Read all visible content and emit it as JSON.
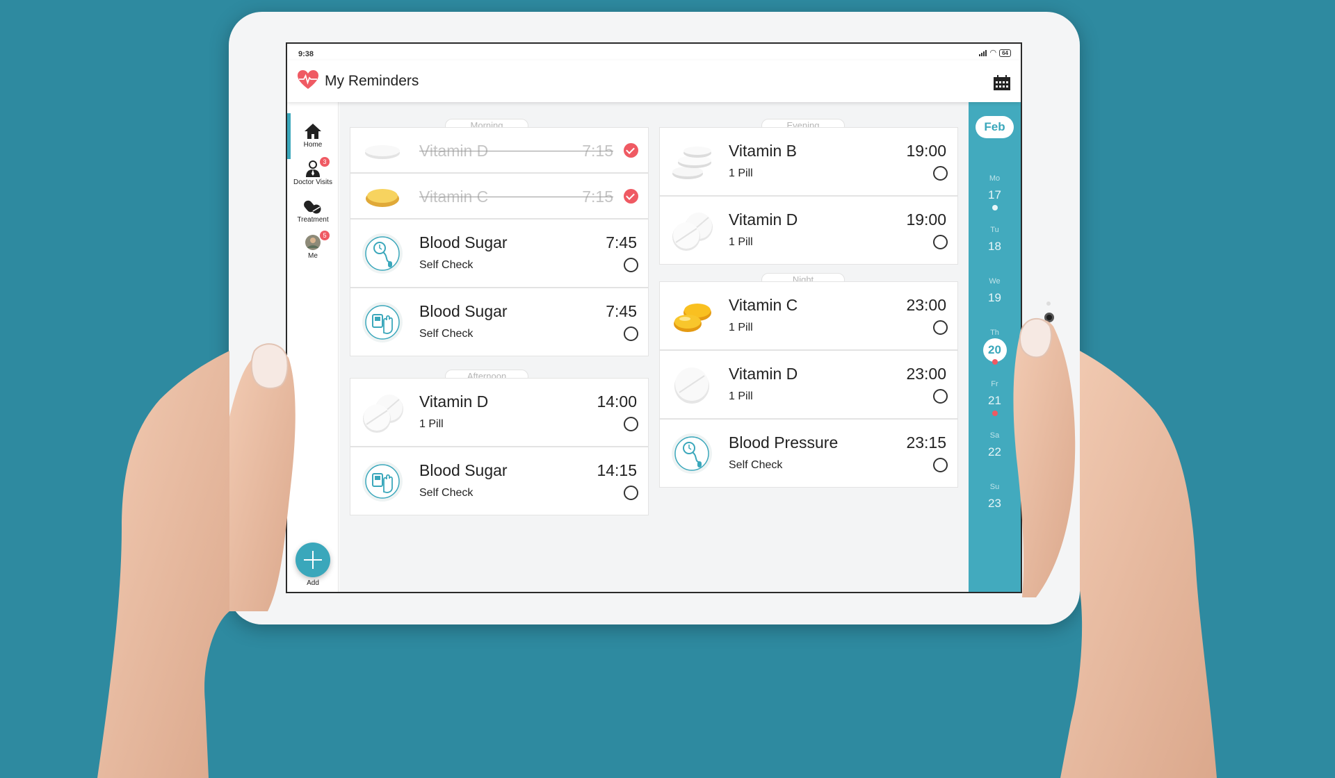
{
  "status_bar": {
    "time": "9:38",
    "battery": "64"
  },
  "app_bar": {
    "title": "My Reminders",
    "logo_icon": "heart-icon",
    "calendar_icon": "calendar-icon"
  },
  "nav": {
    "items": [
      {
        "label": "Home",
        "icon": "home-icon",
        "active": true
      },
      {
        "label": "Doctor Visits",
        "icon": "doctor-icon",
        "badge": "3"
      },
      {
        "label": "Treatment",
        "icon": "pills-icon"
      },
      {
        "label": "Me",
        "icon": "avatar",
        "badge": "5"
      }
    ],
    "add_label": "Add"
  },
  "sections": {
    "morning": {
      "label": "Morning",
      "items": [
        {
          "name": "Vitamin D",
          "time": "7:15",
          "done": true
        },
        {
          "name": "Vitamin C",
          "time": "7:15",
          "done": true
        },
        {
          "name": "Blood Sugar",
          "sub": "Self Check",
          "time": "7:45"
        },
        {
          "name": "Blood Sugar",
          "sub": "Self Check",
          "time": "7:45"
        }
      ]
    },
    "afternoon": {
      "label": "Afternoon",
      "items": [
        {
          "name": "Vitamin D",
          "sub": "1 Pill",
          "time": "14:00"
        },
        {
          "name": "Blood Sugar",
          "sub": "Self Check",
          "time": "14:15"
        }
      ]
    },
    "evening": {
      "label": "Evening",
      "items": [
        {
          "name": "Vitamin B",
          "sub": "1 Pill",
          "time": "19:00"
        },
        {
          "name": "Vitamin D",
          "sub": "1 Pill",
          "time": "19:00"
        }
      ]
    },
    "night": {
      "label": "Night",
      "items": [
        {
          "name": "Vitamin C",
          "sub": "1 Pill",
          "time": "23:00"
        },
        {
          "name": "Vitamin D",
          "sub": "1 Pill",
          "time": "23:00"
        },
        {
          "name": "Blood Pressure",
          "sub": "Self Check",
          "time": "23:15"
        }
      ]
    }
  },
  "week": {
    "month": "Feb",
    "days": [
      {
        "name": "Mo",
        "date": "17",
        "dot": "#e8f6f8"
      },
      {
        "name": "Tu",
        "date": "18"
      },
      {
        "name": "We",
        "date": "19"
      },
      {
        "name": "Th",
        "date": "20",
        "selected": true,
        "dot": "#ef5a63"
      },
      {
        "name": "Fr",
        "date": "21",
        "dot": "#ef5a63"
      },
      {
        "name": "Sa",
        "date": "22"
      },
      {
        "name": "Su",
        "date": "23"
      }
    ]
  },
  "colors": {
    "accent": "#3aa7bb",
    "alert": "#ef5a63",
    "background": "#2e8aa0"
  }
}
